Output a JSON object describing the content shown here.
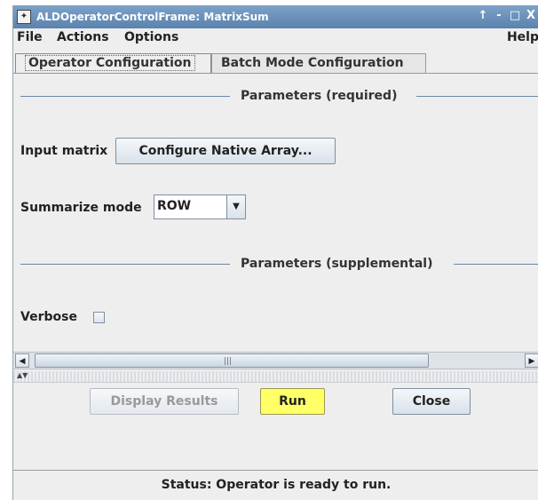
{
  "window": {
    "title": "ALDOperatorControlFrame: MatrixSum",
    "controls": [
      "↑",
      "-",
      "□",
      "X"
    ]
  },
  "menu": [
    "File",
    "Actions",
    "Options"
  ],
  "menu_help": "Help",
  "tabs": [
    {
      "label": "Operator Configuration",
      "active": true
    },
    {
      "label": "Batch Mode Configuration",
      "active": false
    }
  ],
  "sections": {
    "required": "Parameters (required)",
    "supplemental": "Parameters (supplemental)"
  },
  "params": {
    "input_matrix_label": "Input matrix",
    "input_matrix_button": "Configure Native Array...",
    "summarize_label": "Summarize mode",
    "summarize_value": "ROW",
    "verbose_label": "Verbose",
    "verbose_checked": false
  },
  "buttons": {
    "display_results": "Display Results",
    "run": "Run",
    "close": "Close"
  },
  "status": "Status: Operator is ready to run.",
  "colors": {
    "run_button": "#ffff66",
    "titlebar": "#6b90b9"
  }
}
